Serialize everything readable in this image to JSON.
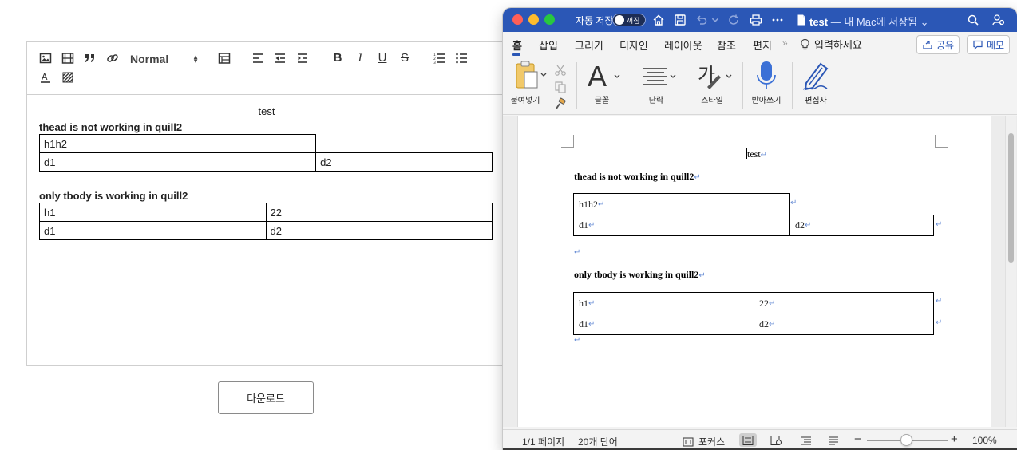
{
  "editor": {
    "toolbar": {
      "header_select": "Normal",
      "bold": "B",
      "italic": "I",
      "underline": "U",
      "strike": "S",
      "color_letter": "A"
    },
    "content": {
      "center_text": "test",
      "heading1": "thead is not working in quill2",
      "table1": [
        [
          "h1h2",
          ""
        ],
        [
          "d1",
          "d2"
        ]
      ],
      "heading2": "only tbody is working in quill2",
      "table2": [
        [
          "h1",
          "22"
        ],
        [
          "d1",
          "d2"
        ]
      ]
    },
    "download_button": "다운로드"
  },
  "word": {
    "autosave_label": "자동 저장",
    "autosave_state": "꺼짐",
    "doc_title": "test",
    "doc_subtitle": "— 내 Mac에 저장됨",
    "tabs": [
      "홈",
      "삽입",
      "그리기",
      "디자인",
      "레이아웃",
      "참조",
      "편지"
    ],
    "tell_me": "입력하세요",
    "share_button": "공유",
    "memo_button": "메모",
    "ribbon": {
      "paste": "붙여넣기",
      "font": "글꼴",
      "paragraph": "단락",
      "styles": "스타일",
      "dictate": "받아쓰기",
      "editor": "편집자",
      "styles_glyph": "가"
    },
    "document": {
      "center_text": "test",
      "heading1": "thead is not working in quill2",
      "table1": [
        [
          "h1h2"
        ],
        [
          "d1",
          "d2"
        ]
      ],
      "heading2": "only tbody is working in quill2",
      "table2": [
        [
          "h1",
          "22"
        ],
        [
          "d1",
          "d2"
        ]
      ],
      "para_mark": "↵"
    },
    "status": {
      "pages": "1/1 페이지",
      "words": "20개 단어",
      "focus": "포커스",
      "zoom": "100%"
    },
    "colors": {
      "titlebar": "#2b57b6",
      "accent": "#2b57b6"
    }
  }
}
